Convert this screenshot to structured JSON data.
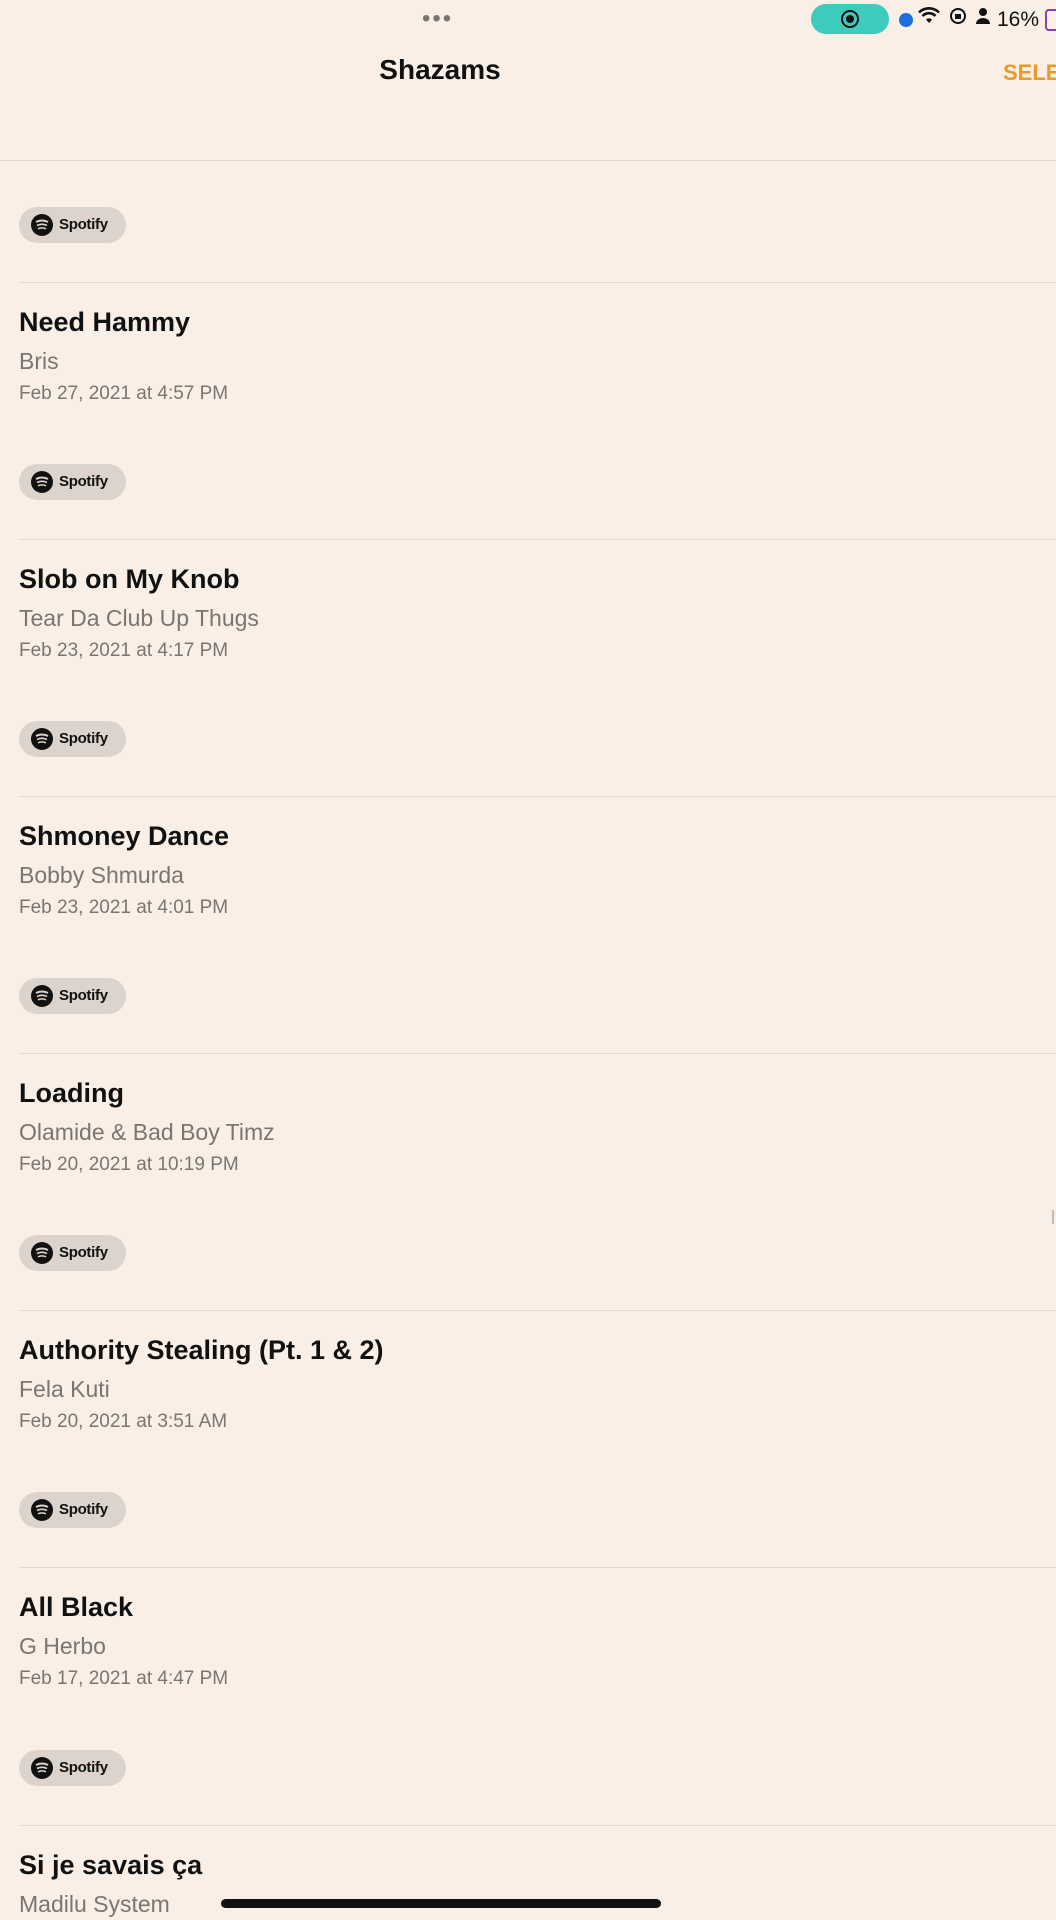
{
  "status_bar": {
    "dots": "•••",
    "battery": "16%"
  },
  "header": {
    "title": "Shazams",
    "select_label": "SELE"
  },
  "spotify_label": "Spotify",
  "songs": [
    {
      "title": "Need Hammy",
      "artist": "Bris",
      "date": "Feb 27, 2021 at 4:57 PM"
    },
    {
      "title": "Slob on My Knob",
      "artist": "Tear Da Club Up Thugs",
      "date": "Feb 23, 2021 at 4:17 PM"
    },
    {
      "title": "Shmoney Dance",
      "artist": "Bobby Shmurda",
      "date": "Feb 23, 2021 at 4:01 PM"
    },
    {
      "title": "Loading",
      "artist": "Olamide & Bad Boy Timz",
      "date": "Feb 20, 2021 at 10:19 PM"
    },
    {
      "title": "Authority Stealing (Pt. 1 & 2)",
      "artist": "Fela Kuti",
      "date": "Feb 20, 2021 at 3:51 AM"
    },
    {
      "title": "All Black",
      "artist": "G Herbo",
      "date": "Feb 17, 2021 at 4:47 PM"
    },
    {
      "title": "Si je savais ça",
      "artist": "Madilu System",
      "date": ""
    }
  ]
}
